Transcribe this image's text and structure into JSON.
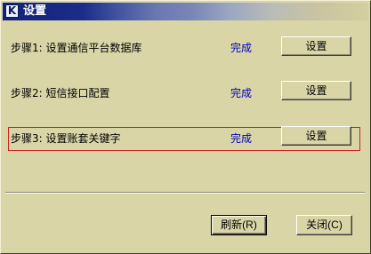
{
  "window": {
    "title": "设置",
    "icon": "app-logo-icon",
    "icon_glyph": "K"
  },
  "steps": [
    {
      "label": "步骤1: 设置通信平台数据库",
      "status": "完成",
      "button": "设置"
    },
    {
      "label": "步骤2: 短信接口配置",
      "status": "完成",
      "button": "设置"
    },
    {
      "label": "步骤3: 设置账套关键字",
      "status": "完成",
      "button": "设置"
    }
  ],
  "footer": {
    "refresh_label": "刷新(R)",
    "close_label": "关闭(C)"
  },
  "colors": {
    "background": "#d9d5a6",
    "status_text": "#0000c0",
    "highlight_border": "#d02020",
    "titlebar_start": "#12227a"
  }
}
